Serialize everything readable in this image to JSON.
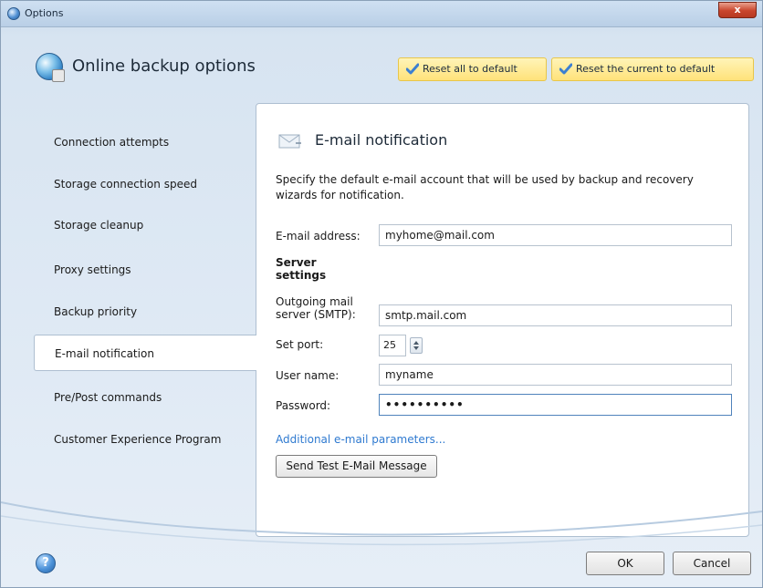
{
  "window": {
    "title": "Options",
    "close_glyph": "x"
  },
  "header": {
    "title": "Online backup options",
    "reset_all_label": "Reset all to default",
    "reset_current_label": "Reset the current to default"
  },
  "sidebar": {
    "items": [
      {
        "label": "Connection attempts",
        "active": false
      },
      {
        "label": "Storage connection speed",
        "active": false
      },
      {
        "label": "Storage cleanup",
        "active": false
      },
      {
        "label": "Proxy settings",
        "active": false
      },
      {
        "label": "Backup priority",
        "active": false
      },
      {
        "label": "E-mail notification",
        "active": true
      },
      {
        "label": "Pre/Post commands",
        "active": false
      },
      {
        "label": "Customer Experience Program",
        "active": false
      }
    ]
  },
  "panel": {
    "title": "E-mail notification",
    "description": "Specify the default e-mail account that will be used by backup and recovery wizards for notification.",
    "email_label": "E-mail address:",
    "email_value": "myhome@mail.com",
    "server_settings_label": "Server settings",
    "smtp_label_line1": "Outgoing mail",
    "smtp_label_line2": "server (SMTP):",
    "smtp_value": "smtp.mail.com",
    "port_label": "Set port:",
    "port_value": "25",
    "username_label": "User name:",
    "username_value": "myname",
    "password_label": "Password:",
    "password_value": "••••••••••",
    "additional_link": "Additional e-mail parameters...",
    "test_button": "Send Test E-Mail Message"
  },
  "footer": {
    "help_glyph": "?",
    "ok_label": "OK",
    "cancel_label": "Cancel"
  },
  "colors": {
    "accent_link": "#2f7ad0",
    "reset_button_bg": "#ffe27a",
    "close_button": "#c9452c"
  },
  "icons": {
    "app": "options-app-icon",
    "header": "globe-backup-icon",
    "reset": "checkmark-icon",
    "panel": "envelope-icon",
    "help": "help-icon"
  }
}
